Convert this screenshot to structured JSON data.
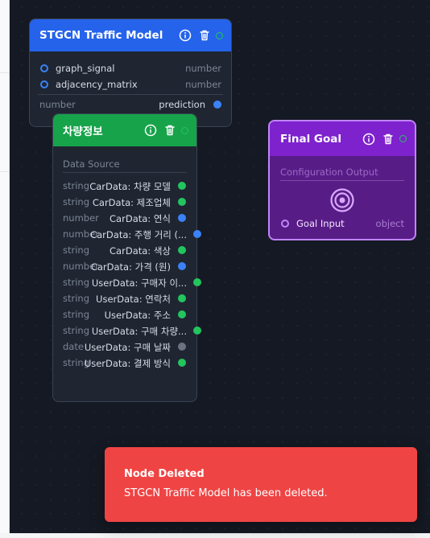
{
  "canvas": {
    "background": "#141923"
  },
  "stgcn_node": {
    "title": "STGCN Traffic Model",
    "header_color": "#2563eb",
    "inputs": [
      {
        "name": "graph_signal",
        "type": "number"
      },
      {
        "name": "adjacency_matrix",
        "type": "number"
      }
    ],
    "output": {
      "type": "number",
      "name": "prediction"
    }
  },
  "vehicle_node": {
    "title": "차량정보",
    "header_color": "#16a34a",
    "section_label": "Data Source",
    "fields": [
      {
        "type": "string",
        "label": "CarData: 차량 모델",
        "port": "green"
      },
      {
        "type": "string",
        "label": "CarData: 제조업체",
        "port": "green"
      },
      {
        "type": "number",
        "label": "CarData: 연식",
        "port": "blue"
      },
      {
        "type": "number",
        "label": "CarData: 주행 거리 (...",
        "port": "blue"
      },
      {
        "type": "string",
        "label": "CarData: 색상",
        "port": "green"
      },
      {
        "type": "number",
        "label": "CarData: 가격 (원)",
        "port": "blue"
      },
      {
        "type": "string",
        "label": "UserData: 구매자 이...",
        "port": "green"
      },
      {
        "type": "string",
        "label": "UserData: 연락처",
        "port": "green"
      },
      {
        "type": "string",
        "label": "UserData: 주소",
        "port": "green"
      },
      {
        "type": "string",
        "label": "UserData: 구매 차량...",
        "port": "green"
      },
      {
        "type": "date",
        "label": "UserData: 구매 날짜",
        "port": "gray"
      },
      {
        "type": "string",
        "label": "UserData: 결제 방식",
        "port": "green"
      }
    ]
  },
  "goal_node": {
    "title": "Final Goal",
    "header_color": "#7e22ce",
    "section_label": "Configuration Output",
    "input": {
      "name": "Goal Input",
      "type": "object"
    }
  },
  "toast": {
    "title": "Node Deleted",
    "message": "STGCN Traffic Model has been deleted."
  }
}
